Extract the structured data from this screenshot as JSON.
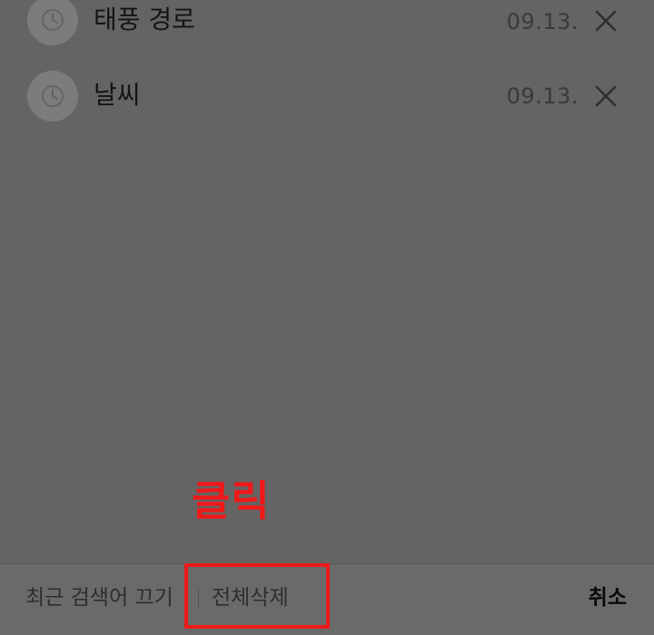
{
  "history": [
    {
      "keyword": "태풍 경로",
      "date": "09.13.",
      "icon": "clock-icon",
      "delete_icon": "close-icon"
    },
    {
      "keyword": "날씨",
      "date": "09.13.",
      "icon": "clock-icon",
      "delete_icon": "close-icon"
    }
  ],
  "bottom_bar": {
    "turn_off_label": "최근 검색어 끄기",
    "delete_all_label": "전체삭제",
    "cancel_label": "취소"
  },
  "annotation": {
    "text": "클릭",
    "color": "#ee1a1a"
  }
}
